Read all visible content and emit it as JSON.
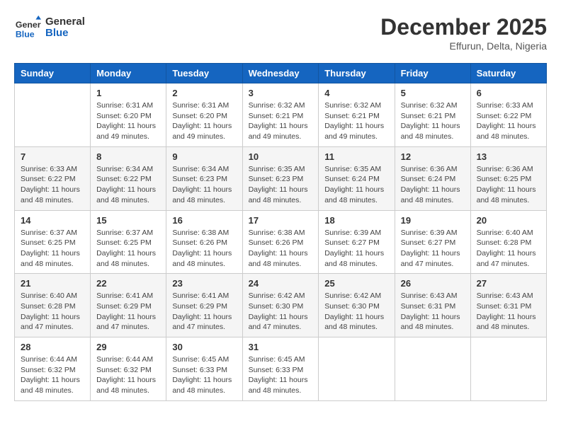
{
  "logo": {
    "general": "General",
    "blue": "Blue"
  },
  "header": {
    "title": "December 2025",
    "subtitle": "Effurun, Delta, Nigeria"
  },
  "days_of_week": [
    "Sunday",
    "Monday",
    "Tuesday",
    "Wednesday",
    "Thursday",
    "Friday",
    "Saturday"
  ],
  "weeks": [
    [
      {
        "day": "",
        "sunrise": "",
        "sunset": "",
        "daylight": ""
      },
      {
        "day": "1",
        "sunrise": "Sunrise: 6:31 AM",
        "sunset": "Sunset: 6:20 PM",
        "daylight": "Daylight: 11 hours and 49 minutes."
      },
      {
        "day": "2",
        "sunrise": "Sunrise: 6:31 AM",
        "sunset": "Sunset: 6:20 PM",
        "daylight": "Daylight: 11 hours and 49 minutes."
      },
      {
        "day": "3",
        "sunrise": "Sunrise: 6:32 AM",
        "sunset": "Sunset: 6:21 PM",
        "daylight": "Daylight: 11 hours and 49 minutes."
      },
      {
        "day": "4",
        "sunrise": "Sunrise: 6:32 AM",
        "sunset": "Sunset: 6:21 PM",
        "daylight": "Daylight: 11 hours and 49 minutes."
      },
      {
        "day": "5",
        "sunrise": "Sunrise: 6:32 AM",
        "sunset": "Sunset: 6:21 PM",
        "daylight": "Daylight: 11 hours and 48 minutes."
      },
      {
        "day": "6",
        "sunrise": "Sunrise: 6:33 AM",
        "sunset": "Sunset: 6:22 PM",
        "daylight": "Daylight: 11 hours and 48 minutes."
      }
    ],
    [
      {
        "day": "7",
        "sunrise": "Sunrise: 6:33 AM",
        "sunset": "Sunset: 6:22 PM",
        "daylight": "Daylight: 11 hours and 48 minutes."
      },
      {
        "day": "8",
        "sunrise": "Sunrise: 6:34 AM",
        "sunset": "Sunset: 6:22 PM",
        "daylight": "Daylight: 11 hours and 48 minutes."
      },
      {
        "day": "9",
        "sunrise": "Sunrise: 6:34 AM",
        "sunset": "Sunset: 6:23 PM",
        "daylight": "Daylight: 11 hours and 48 minutes."
      },
      {
        "day": "10",
        "sunrise": "Sunrise: 6:35 AM",
        "sunset": "Sunset: 6:23 PM",
        "daylight": "Daylight: 11 hours and 48 minutes."
      },
      {
        "day": "11",
        "sunrise": "Sunrise: 6:35 AM",
        "sunset": "Sunset: 6:24 PM",
        "daylight": "Daylight: 11 hours and 48 minutes."
      },
      {
        "day": "12",
        "sunrise": "Sunrise: 6:36 AM",
        "sunset": "Sunset: 6:24 PM",
        "daylight": "Daylight: 11 hours and 48 minutes."
      },
      {
        "day": "13",
        "sunrise": "Sunrise: 6:36 AM",
        "sunset": "Sunset: 6:25 PM",
        "daylight": "Daylight: 11 hours and 48 minutes."
      }
    ],
    [
      {
        "day": "14",
        "sunrise": "Sunrise: 6:37 AM",
        "sunset": "Sunset: 6:25 PM",
        "daylight": "Daylight: 11 hours and 48 minutes."
      },
      {
        "day": "15",
        "sunrise": "Sunrise: 6:37 AM",
        "sunset": "Sunset: 6:25 PM",
        "daylight": "Daylight: 11 hours and 48 minutes."
      },
      {
        "day": "16",
        "sunrise": "Sunrise: 6:38 AM",
        "sunset": "Sunset: 6:26 PM",
        "daylight": "Daylight: 11 hours and 48 minutes."
      },
      {
        "day": "17",
        "sunrise": "Sunrise: 6:38 AM",
        "sunset": "Sunset: 6:26 PM",
        "daylight": "Daylight: 11 hours and 48 minutes."
      },
      {
        "day": "18",
        "sunrise": "Sunrise: 6:39 AM",
        "sunset": "Sunset: 6:27 PM",
        "daylight": "Daylight: 11 hours and 48 minutes."
      },
      {
        "day": "19",
        "sunrise": "Sunrise: 6:39 AM",
        "sunset": "Sunset: 6:27 PM",
        "daylight": "Daylight: 11 hours and 47 minutes."
      },
      {
        "day": "20",
        "sunrise": "Sunrise: 6:40 AM",
        "sunset": "Sunset: 6:28 PM",
        "daylight": "Daylight: 11 hours and 47 minutes."
      }
    ],
    [
      {
        "day": "21",
        "sunrise": "Sunrise: 6:40 AM",
        "sunset": "Sunset: 6:28 PM",
        "daylight": "Daylight: 11 hours and 47 minutes."
      },
      {
        "day": "22",
        "sunrise": "Sunrise: 6:41 AM",
        "sunset": "Sunset: 6:29 PM",
        "daylight": "Daylight: 11 hours and 47 minutes."
      },
      {
        "day": "23",
        "sunrise": "Sunrise: 6:41 AM",
        "sunset": "Sunset: 6:29 PM",
        "daylight": "Daylight: 11 hours and 47 minutes."
      },
      {
        "day": "24",
        "sunrise": "Sunrise: 6:42 AM",
        "sunset": "Sunset: 6:30 PM",
        "daylight": "Daylight: 11 hours and 47 minutes."
      },
      {
        "day": "25",
        "sunrise": "Sunrise: 6:42 AM",
        "sunset": "Sunset: 6:30 PM",
        "daylight": "Daylight: 11 hours and 48 minutes."
      },
      {
        "day": "26",
        "sunrise": "Sunrise: 6:43 AM",
        "sunset": "Sunset: 6:31 PM",
        "daylight": "Daylight: 11 hours and 48 minutes."
      },
      {
        "day": "27",
        "sunrise": "Sunrise: 6:43 AM",
        "sunset": "Sunset: 6:31 PM",
        "daylight": "Daylight: 11 hours and 48 minutes."
      }
    ],
    [
      {
        "day": "28",
        "sunrise": "Sunrise: 6:44 AM",
        "sunset": "Sunset: 6:32 PM",
        "daylight": "Daylight: 11 hours and 48 minutes."
      },
      {
        "day": "29",
        "sunrise": "Sunrise: 6:44 AM",
        "sunset": "Sunset: 6:32 PM",
        "daylight": "Daylight: 11 hours and 48 minutes."
      },
      {
        "day": "30",
        "sunrise": "Sunrise: 6:45 AM",
        "sunset": "Sunset: 6:33 PM",
        "daylight": "Daylight: 11 hours and 48 minutes."
      },
      {
        "day": "31",
        "sunrise": "Sunrise: 6:45 AM",
        "sunset": "Sunset: 6:33 PM",
        "daylight": "Daylight: 11 hours and 48 minutes."
      },
      {
        "day": "",
        "sunrise": "",
        "sunset": "",
        "daylight": ""
      },
      {
        "day": "",
        "sunrise": "",
        "sunset": "",
        "daylight": ""
      },
      {
        "day": "",
        "sunrise": "",
        "sunset": "",
        "daylight": ""
      }
    ]
  ]
}
